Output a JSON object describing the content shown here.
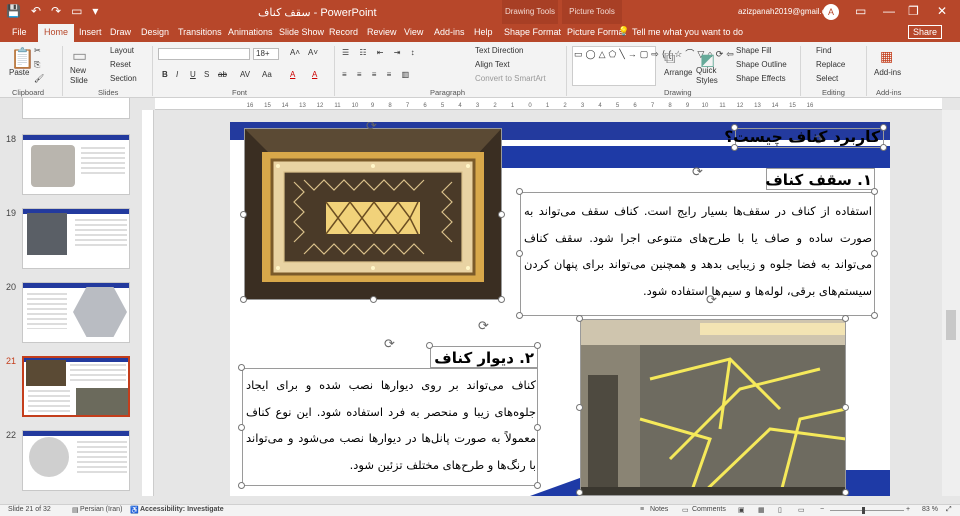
{
  "window": {
    "title": "سقف کناف  -  PowerPoint",
    "context_drawing": "Drawing Tools",
    "context_picture": "Picture Tools",
    "user_email": "azizpanah2019@gmail.com",
    "avatar_letter": "A"
  },
  "qat": {
    "save": "💾",
    "undo": "↶",
    "redo": "↷",
    "present": "▭",
    "more": "▾"
  },
  "tabs": [
    "File",
    "Home",
    "Insert",
    "Draw",
    "Design",
    "Transitions",
    "Animations",
    "Slide Show",
    "Record",
    "Review",
    "View",
    "Add-ins",
    "Help",
    "Shape Format",
    "Picture Format"
  ],
  "tell_me": "Tell me what you want to do",
  "share": "Share",
  "ribbon": {
    "clipboard": {
      "paste": "Paste",
      "label": "Clipboard"
    },
    "slides": {
      "new_slide": "New Slide",
      "layout": "Layout",
      "reset": "Reset",
      "section": "Section",
      "label": "Slides"
    },
    "font": {
      "name": "",
      "size": "18+",
      "label": "Font",
      "bold": "B",
      "italic": "I",
      "underline": "U",
      "strike": "S",
      "shadow": "ab",
      "spacing": "AV",
      "case": "Aa",
      "font_color": "A",
      "highlight": "A",
      "clear": "A"
    },
    "paragraph": {
      "text_direction": "Text Direction",
      "align_text": "Align Text",
      "convert": "Convert to SmartArt",
      "label": "Paragraph"
    },
    "drawing": {
      "arrange": "Arrange",
      "quick_styles": "Quick Styles",
      "shape_fill": "Shape Fill",
      "shape_outline": "Shape Outline",
      "shape_effects": "Shape Effects",
      "label": "Drawing"
    },
    "editing": {
      "find": "Find",
      "replace": "Replace",
      "select": "Select",
      "label": "Editing"
    },
    "addins": {
      "addins": "Add-ins",
      "label": "Add-ins"
    }
  },
  "ruler_numbers": [
    "16",
    "15",
    "14",
    "13",
    "12",
    "11",
    "10",
    "9",
    "8",
    "7",
    "6",
    "5",
    "4",
    "3",
    "2",
    "1",
    "0",
    "1",
    "2",
    "3",
    "4",
    "5",
    "6",
    "7",
    "8",
    "9",
    "10",
    "11",
    "12",
    "13",
    "14",
    "15",
    "16"
  ],
  "thumbnails": [
    {
      "num": "18"
    },
    {
      "num": "19"
    },
    {
      "num": "20"
    },
    {
      "num": "21",
      "active": true
    },
    {
      "num": "22"
    }
  ],
  "slide": {
    "title": "کاربرد کناف چیست؟",
    "h1": "۱. سقف کناف",
    "p1": "استفاده از کناف در سقف‌ها بسیار رایج است. کناف سقف می‌تواند به صورت ساده و صاف یا با طرح‌های متنوعی اجرا شود. سقف کناف می‌تواند به فضا جلوه و زیبایی بدهد و همچنین می‌تواند برای پنهان کردن سیستم‌های برقی، لوله‌ها و سیم‌ها استفاده شود.",
    "h2": "۲. دیوار کناف",
    "p2": "کناف می‌تواند بر روی دیوارها نصب شده و برای ایجاد جلوه‌های زیبا و منحصر به فرد استفاده شود. این نوع کناف معمولاً به صورت پانل‌ها در دیوارها نصب می‌شود و می‌تواند با رنگ‌ها و طرح‌های مختلف تزئین شود."
  },
  "status": {
    "slide": "Slide 21 of 32",
    "language": "Persian (Iran)",
    "accessibility": "Accessibility: Investigate",
    "notes": "Notes",
    "comments": "Comments",
    "zoom": "83 %"
  },
  "colors": {
    "accent": "#b7472a",
    "slide_blue": "#233a9e"
  }
}
